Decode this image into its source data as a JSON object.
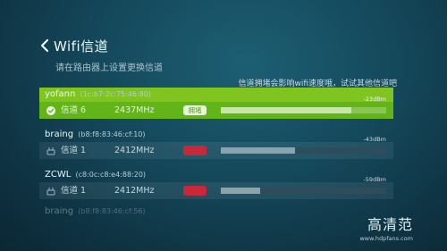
{
  "header": {
    "title": "Wifi信道",
    "subtitle": "请在路由器上设置更换信道"
  },
  "hint": "信道拥堵会影响wifi速度哦，试试其他信道吧",
  "networks": [
    {
      "name": "yofann",
      "mac": "(1c:b7:2c:75:46:80)",
      "channel": "信道 6",
      "freq": "2437MHz",
      "badge": "拥堵",
      "dbm": "-23dBm",
      "signal": 0.79,
      "state": "selected"
    },
    {
      "name": "braing",
      "mac": "(b8:f8:83:46:cf:10)",
      "channel": "信道 1",
      "freq": "2412MHz",
      "badge": "",
      "dbm": "-43dBm",
      "signal": 0.45,
      "state": "normal"
    },
    {
      "name": "ZCWL",
      "mac": "(c8:0c:c8:e4:88:20)",
      "channel": "信道 1",
      "freq": "2412MHz",
      "badge": "",
      "dbm": "-59dBm",
      "signal": 0.24,
      "state": "normal"
    },
    {
      "name": "braing",
      "mac": "(b8:f8:83:46:cf:56)",
      "state": "faded"
    }
  ],
  "watermark": {
    "logo": "高清范",
    "url": "www.hdpfans.com"
  },
  "colors": {
    "selected": "#6ab71b",
    "badge_red": "#c8283a",
    "bg": "#14475a"
  }
}
